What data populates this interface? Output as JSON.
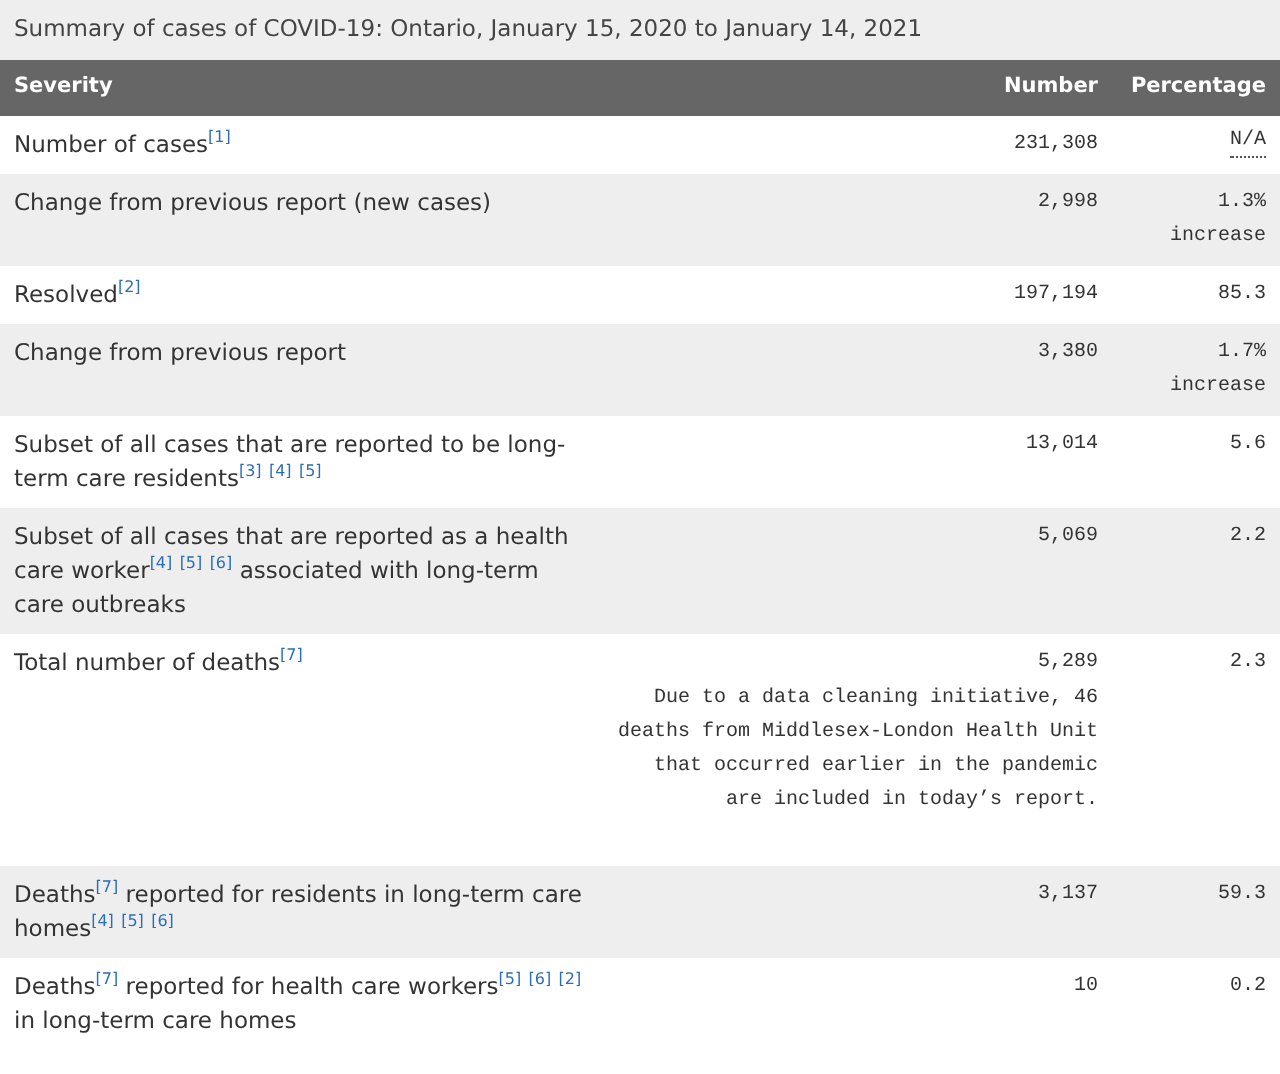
{
  "caption": "Summary of cases of COVID-19: Ontario, January 15, 2020 to January 14, 2021",
  "columns": [
    "Severity",
    "Number",
    "Percentage"
  ],
  "rows": [
    {
      "severity": [
        {
          "kind": "text",
          "text": "Number of cases"
        },
        {
          "kind": "ref",
          "text": "[1]"
        }
      ],
      "number": "231,308",
      "percentage": "N/A",
      "percentage_abbreviated": true
    },
    {
      "severity": [
        {
          "kind": "text",
          "text": "Change from previous report (new cases)"
        }
      ],
      "number": "2,998",
      "percentage": "1.3%",
      "percentage_note": "increase"
    },
    {
      "severity": [
        {
          "kind": "text",
          "text": "Resolved"
        },
        {
          "kind": "ref",
          "text": "[2]"
        }
      ],
      "number": "197,194",
      "percentage": "85.3"
    },
    {
      "severity": [
        {
          "kind": "text",
          "text": "Change from previous report"
        }
      ],
      "number": "3,380",
      "percentage": "1.7%",
      "percentage_note": "increase"
    },
    {
      "severity": [
        {
          "kind": "text",
          "text": "Subset of all cases that are reported to be long-term care residents"
        },
        {
          "kind": "ref",
          "text": "[3]"
        },
        {
          "kind": "ref",
          "text": "[4]"
        },
        {
          "kind": "ref",
          "text": "[5]"
        }
      ],
      "number": "13,014",
      "percentage": "5.6"
    },
    {
      "severity": [
        {
          "kind": "text",
          "text": "Subset of all cases that are reported as a health care worker"
        },
        {
          "kind": "ref",
          "text": "[4]"
        },
        {
          "kind": "ref",
          "text": "[5]"
        },
        {
          "kind": "ref",
          "text": "[6]"
        },
        {
          "kind": "text",
          "text": "associated with long-term care outbreaks"
        }
      ],
      "number": "5,069",
      "percentage": "2.2"
    },
    {
      "severity": [
        {
          "kind": "text",
          "text": "Total number of deaths"
        },
        {
          "kind": "ref",
          "text": "[7]"
        }
      ],
      "number": "5,289",
      "number_note": "Due to a data cleaning initiative, 46 deaths from Middlesex-London Health Unit that occurred earlier in the pandemic are included in today’s report.",
      "percentage": "2.3"
    },
    {
      "severity": [
        {
          "kind": "text",
          "text": "Deaths"
        },
        {
          "kind": "ref",
          "text": "[7]"
        },
        {
          "kind": "text",
          "text": "reported for residents in long-term care homes"
        },
        {
          "kind": "ref",
          "text": "[4]"
        },
        {
          "kind": "ref",
          "text": "[5]"
        },
        {
          "kind": "ref",
          "text": "[6]"
        }
      ],
      "number": "3,137",
      "percentage": "59.3"
    },
    {
      "severity": [
        {
          "kind": "text",
          "text": "Deaths"
        },
        {
          "kind": "ref",
          "text": "[7]"
        },
        {
          "kind": "text",
          "text": "reported for health care workers"
        },
        {
          "kind": "ref",
          "text": "[5]"
        },
        {
          "kind": "ref",
          "text": "[6]"
        },
        {
          "kind": "ref",
          "text": "[2]"
        },
        {
          "kind": "text",
          "text": "in long-term care homes"
        }
      ],
      "number": "10",
      "percentage": "0.2"
    }
  ]
}
